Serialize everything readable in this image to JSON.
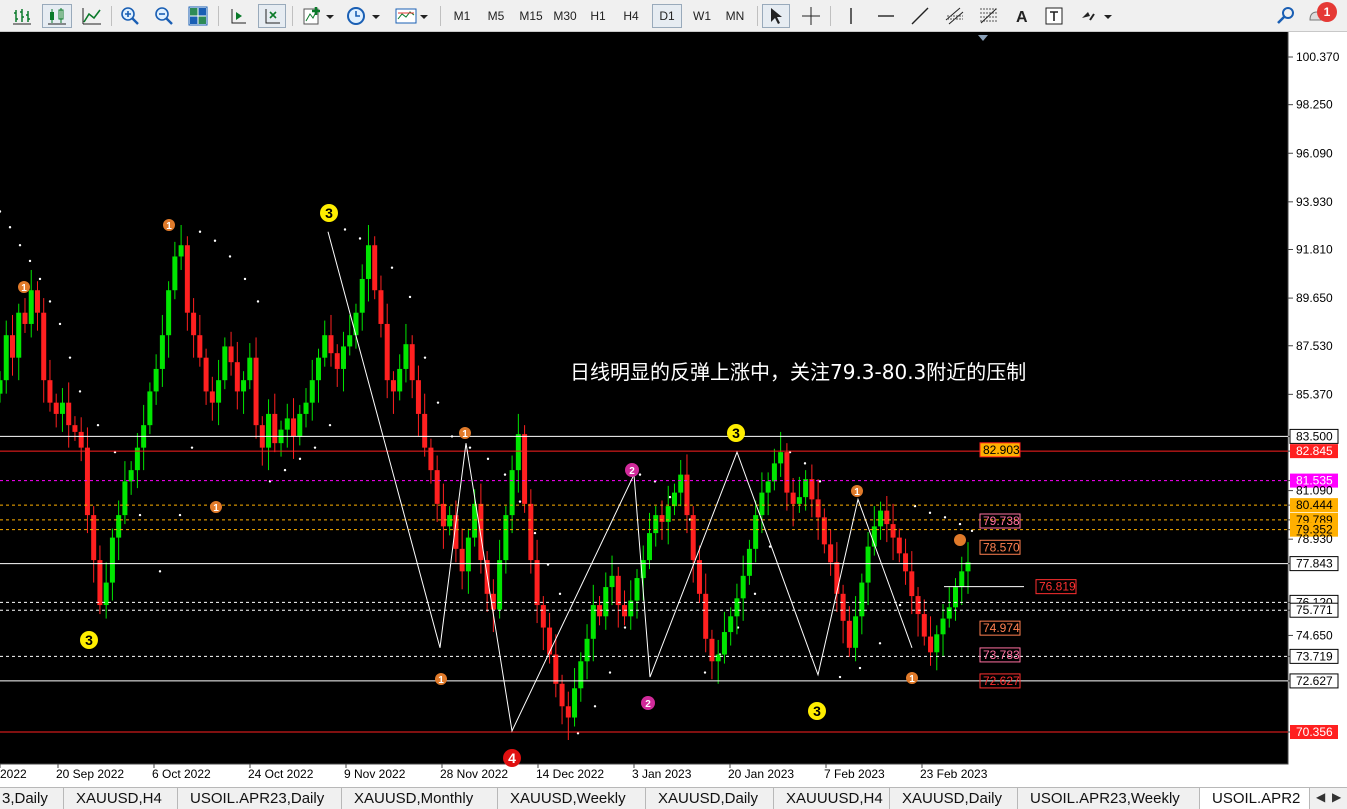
{
  "toolbar": {
    "timeframes": [
      "M1",
      "M5",
      "M15",
      "M30",
      "H1",
      "H4",
      "D1",
      "W1",
      "MN"
    ],
    "active_timeframe": "D1",
    "notification_count": "1"
  },
  "chart": {
    "symbol": "USOIL.APR23",
    "timeframe": "Daily",
    "annotation": "日线明显的反弹上涨中，关注79.3-80.3附近的压制",
    "colors": {
      "background": "#000000",
      "bull": "#00e600",
      "bear": "#ff2020",
      "grid": "#ffffff"
    },
    "price_axis_labels": [
      "100.370",
      "98.250",
      "96.090",
      "93.930",
      "91.810",
      "89.650",
      "87.530",
      "85.370",
      "83.500",
      "82.845",
      "81.535",
      "81.090",
      "80.444",
      "79.789",
      "79.352",
      "78.930",
      "77.843",
      "76.120",
      "75.771",
      "74.650",
      "73.719",
      "72.627",
      "70.356"
    ],
    "date_axis_labels": [
      "2022",
      "20 Sep 2022",
      "6 Oct 2022",
      "24 Oct 2022",
      "9 Nov 2022",
      "28 Nov 2022",
      "14 Dec 2022",
      "3 Jan 2023",
      "20 Jan 2023",
      "7 Feb 2023",
      "23 Feb 2023"
    ],
    "level_labels": [
      "82.903",
      "79.738",
      "78.570",
      "76.819",
      "74.974",
      "73.783",
      "72.627"
    ],
    "wave_markers": [
      "3",
      "1",
      "1",
      "1",
      "3",
      "3",
      "1",
      "2",
      "4",
      "2",
      "3",
      "3",
      "1",
      "1",
      "1"
    ],
    "horizontal_levels": [
      {
        "price": 83.5,
        "color": "#ffffff",
        "style": "solid"
      },
      {
        "price": 82.845,
        "color": "#ff2020",
        "style": "solid"
      },
      {
        "price": 81.535,
        "color": "#ff00ff",
        "style": "dashed"
      },
      {
        "price": 80.444,
        "color": "#ffb000",
        "style": "dashed"
      },
      {
        "price": 79.789,
        "color": "#ffb000",
        "style": "dashed"
      },
      {
        "price": 79.352,
        "color": "#ffb000",
        "style": "dashed"
      },
      {
        "price": 77.843,
        "color": "#ffffff",
        "style": "solid"
      },
      {
        "price": 76.12,
        "color": "#ffffff",
        "style": "dashed"
      },
      {
        "price": 75.771,
        "color": "#ffffff",
        "style": "dashed"
      },
      {
        "price": 73.719,
        "color": "#ffffff",
        "style": "dashed"
      },
      {
        "price": 72.627,
        "color": "#ffffff",
        "style": "solid"
      },
      {
        "price": 70.356,
        "color": "#ff2020",
        "style": "solid"
      }
    ]
  },
  "tabs": [
    "3,Daily",
    "XAUUSD,H4",
    "USOIL.APR23,Daily",
    "XAUUSD,Monthly",
    "XAUUSD,Weekly",
    "XAUUSD,Daily",
    "XAUUUSD,H4",
    "XAUUSD,Daily",
    "USOIL.APR23,Weekly",
    "USOIL.APR2"
  ],
  "active_tab": "USOIL.APR2"
}
